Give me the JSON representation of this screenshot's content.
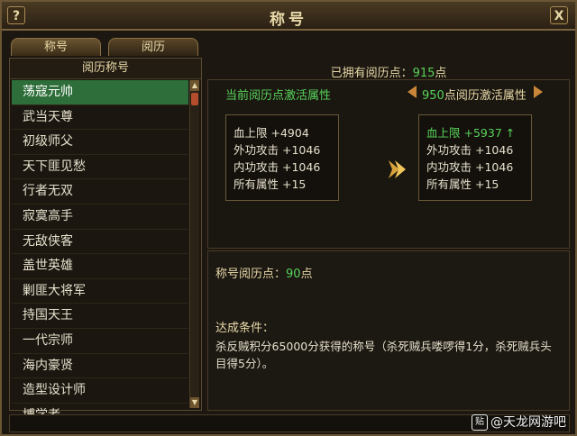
{
  "window": {
    "title": "称号",
    "help_label": "?",
    "close_label": "X"
  },
  "tabs": [
    {
      "label": "称号"
    },
    {
      "label": "阅历"
    }
  ],
  "left": {
    "header": "阅历称号",
    "items": [
      {
        "label": "荡寇元帅"
      },
      {
        "label": "武当天尊"
      },
      {
        "label": "初级师父"
      },
      {
        "label": "天下匪见愁"
      },
      {
        "label": "行者无双"
      },
      {
        "label": "寂寞高手"
      },
      {
        "label": "无敌侠客"
      },
      {
        "label": "盖世英雄"
      },
      {
        "label": "剿匪大将军"
      },
      {
        "label": "持国天王"
      },
      {
        "label": "一代宗师"
      },
      {
        "label": "海内豪贤"
      },
      {
        "label": "造型设计师"
      },
      {
        "label": "博学者"
      }
    ],
    "selected_index": 0
  },
  "owned": {
    "label": "已拥有阅历点：",
    "value": "915",
    "unit": "点"
  },
  "current": {
    "prefix": "当前",
    "header": "阅历点激活属性",
    "stats": [
      {
        "name": "血上限",
        "value": "+4904"
      },
      {
        "name": "外功攻击",
        "value": "+1046"
      },
      {
        "name": "内功攻击",
        "value": "+1046"
      },
      {
        "name": "所有属性",
        "value": "+15"
      }
    ]
  },
  "next": {
    "points": "950",
    "header": "点阅历激活属性",
    "stats": [
      {
        "name": "血上限",
        "value": "+5937",
        "up": "↑"
      },
      {
        "name": "外功攻击",
        "value": "+1046"
      },
      {
        "name": "内功攻击",
        "value": "+1046"
      },
      {
        "name": "所有属性",
        "value": "+15"
      }
    ]
  },
  "title_points": {
    "label": "称号阅历点：",
    "value": "90",
    "unit": "点"
  },
  "condition": {
    "label": "达成条件：",
    "text": "杀反贼积分65000分获得的称号（杀死贼兵喽啰得1分，杀死贼兵头目得5分）。"
  },
  "watermark": {
    "icon": "贴",
    "text": "@天龙网游吧"
  },
  "colors": {
    "accent_green": "#58d35a",
    "gold": "#e8d9a8",
    "selected_bg": "#2e6e3a"
  }
}
